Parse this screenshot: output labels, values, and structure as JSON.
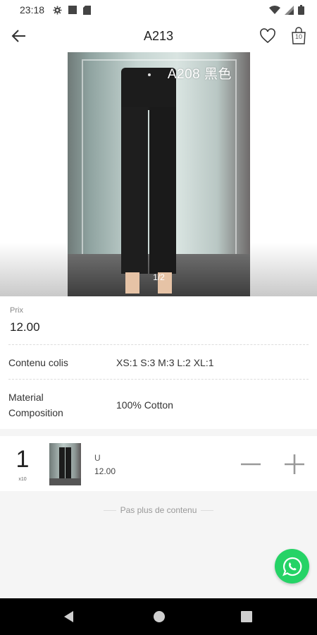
{
  "status_bar": {
    "time": "23:18",
    "left_icons": [
      "settings-icon",
      "square-icon",
      "sd-card-icon"
    ],
    "right_icons": [
      "wifi-icon",
      "signal-icon",
      "battery-icon"
    ]
  },
  "header": {
    "title": "A213",
    "cart_count": "10",
    "icons": [
      "back-arrow-icon",
      "heart-icon",
      "shopping-bag-icon"
    ]
  },
  "gallery": {
    "overlay_label": "A208 黑色",
    "pager": "1/2"
  },
  "details": {
    "price_label": "Prix",
    "price_value": "12.00",
    "rows": [
      {
        "label": "Contenu colis",
        "value": "XS:1 S:3 M:3 L:2 XL:1"
      },
      {
        "label_line1": "Material",
        "label_line2": "Composition",
        "value": "100% Cotton"
      }
    ]
  },
  "cart_line": {
    "quantity": "1",
    "multiplier": "x10",
    "variant": "U",
    "price": "12.00"
  },
  "footer": {
    "end_text": "Pas plus de contenu"
  },
  "colors": {
    "whatsapp": "#25d366",
    "navbar": "#000000"
  }
}
